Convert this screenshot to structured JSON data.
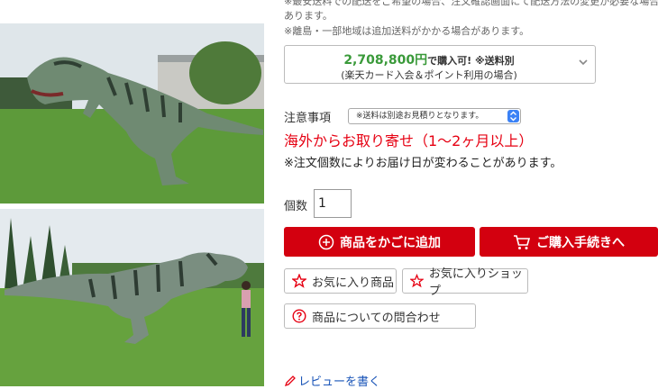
{
  "shipping_notes": [
    "※最安送料での配送をご希望の場合、注文確認画面にて配送方法の変更が必要な場合が",
    "あります。",
    "※離島・一部地域は追加送料がかかる場合があります。"
  ],
  "price_box": {
    "amount": "2,708,800円",
    "suffix": "で購入可! ※送料別",
    "condition": "(楽天カード入会＆ポイント利用の場合)"
  },
  "caution": {
    "label": "注意事項",
    "selected": "※送料は別途お見積りとなります。"
  },
  "overseas_notice": "海外からお取り寄せ（1〜2ヶ月以上）",
  "order_note": "※注文個数によりお届け日が変わることがあります。",
  "quantity": {
    "label": "個数",
    "value": "1"
  },
  "buttons": {
    "add_to_cart": "商品をかごに追加",
    "checkout": "ご購入手続きへ",
    "favorite_item": "お気に入り商品",
    "favorite_shop": "お気に入りショップ",
    "inquiry": "商品についての問合わせ"
  },
  "review_link": "レビューを書く",
  "colors": {
    "brand_red": "#d3000f",
    "price_green": "#3a9a3a",
    "link_blue": "#1a55b8"
  }
}
